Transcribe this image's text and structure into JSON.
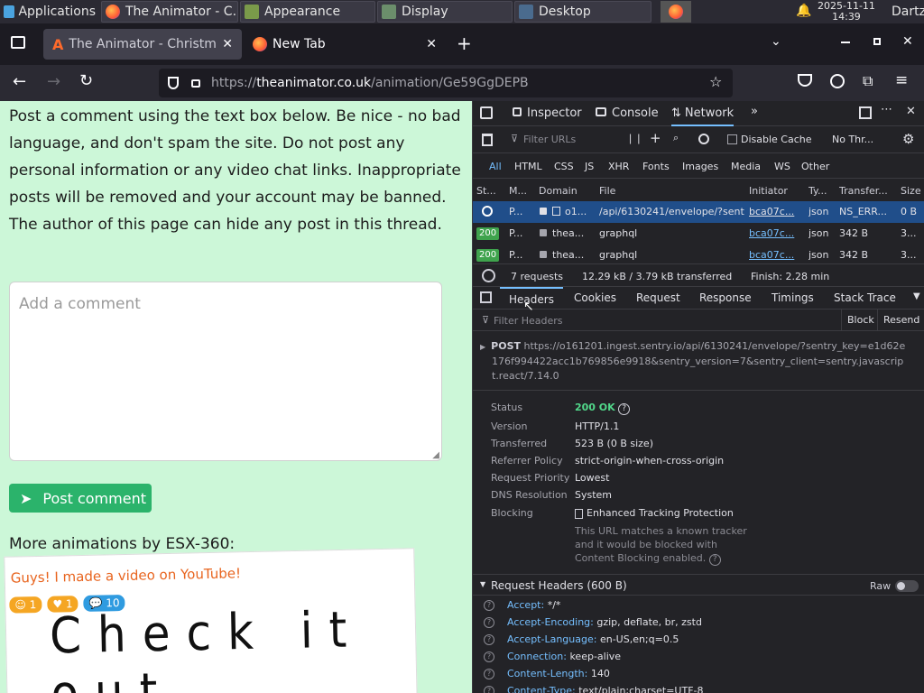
{
  "taskbar": {
    "applications_label": "Applications",
    "windows": [
      {
        "label": "The Animator - C..."
      },
      {
        "label": "Appearance"
      },
      {
        "label": "Display"
      },
      {
        "label": "Desktop"
      }
    ],
    "clock_date": "2025-11-11",
    "clock_time": "14:39",
    "user": "Dartz"
  },
  "tabs": [
    {
      "label": "The Animator - Christma",
      "active": true
    },
    {
      "label": "New Tab",
      "active": false
    }
  ],
  "url": {
    "prefix": "https://",
    "domain": "theanimator.co.uk",
    "path": "/animation/Ge59GgDEPB"
  },
  "page": {
    "notice": "Post a comment using the text box below. Be nice - no bad language, and don't spam the site. Do not post any personal information or any video chat links. Inappropriate posts will be removed and your account may be banned. The author of this page can hide any post in this thread.",
    "comment_placeholder": "Add a comment",
    "post_button": "Post comment",
    "more_by": "More animations by ESX-360:",
    "card_title": "Guys! I made a video on YouTube!",
    "card_counts": [
      "1",
      "1",
      "10"
    ],
    "card_drawing_text": "Check it out"
  },
  "devtools": {
    "tabs": [
      "Inspector",
      "Console",
      "Network"
    ],
    "filter_urls_placeholder": "Filter URLs",
    "disable_cache": "Disable Cache",
    "throttle": "No Thr...",
    "type_filters": [
      "All",
      "HTML",
      "CSS",
      "JS",
      "XHR",
      "Fonts",
      "Images",
      "Media",
      "WS",
      "Other"
    ],
    "columns": [
      "St...",
      "M...",
      "Domain",
      "File",
      "Initiator",
      "Ty...",
      "Transfer...",
      "Size"
    ],
    "requests": [
      {
        "status": "",
        "method": "P...",
        "domain": "o1...",
        "file": "/api/6130241/envelope/?sent",
        "initiator": "bca07c...",
        "type": "json",
        "transferred": "NS_ERR...",
        "size": "0 B",
        "selected": true
      },
      {
        "status": "200",
        "method": "P...",
        "domain": "thea...",
        "file": "graphql",
        "initiator": "bca07c...",
        "type": "json",
        "transferred": "342 B",
        "size": "3...",
        "selected": false
      },
      {
        "status": "200",
        "method": "P...",
        "domain": "thea...",
        "file": "graphql",
        "initiator": "bca07c...",
        "type": "json",
        "transferred": "342 B",
        "size": "3...",
        "selected": false
      }
    ],
    "summary_requests": "7 requests",
    "summary_transfer": "12.29 kB / 3.79 kB transferred",
    "summary_finish": "Finish: 2.28 min",
    "detail_tabs": [
      "Headers",
      "Cookies",
      "Request",
      "Response",
      "Timings",
      "Stack Trace"
    ],
    "filter_headers_placeholder": "Filter Headers",
    "block_label": "Block",
    "resend_label": "Resend",
    "request_line_method": "POST",
    "request_url_1": "https://o161201.ingest.sentry.io/api/6130241/envelope/?sentry_key=e1d62e",
    "request_url_2": "176f994422acc1b769856e9918&sentry_version=7&sentry_client=sentry.javascrip",
    "request_url_3": "t.react/7.14.0",
    "details": [
      {
        "key": "Status",
        "value": "200 OK"
      },
      {
        "key": "Version",
        "value": "HTTP/1.1"
      },
      {
        "key": "Transferred",
        "value": "523 B (0 B size)"
      },
      {
        "key": "Referrer Policy",
        "value": "strict-origin-when-cross-origin"
      },
      {
        "key": "Request Priority",
        "value": "Lowest"
      },
      {
        "key": "DNS Resolution",
        "value": "System"
      },
      {
        "key": "Blocking",
        "value": "Enhanced Tracking Protection"
      }
    ],
    "blocking_note_1": "This URL matches a known tracker",
    "blocking_note_2": "and it would be blocked with",
    "blocking_note_3": "Content Blocking enabled.",
    "request_headers_title": "Request Headers (600 B)",
    "raw_label": "Raw",
    "headers": [
      {
        "name": "Accept:",
        "value": "*/*"
      },
      {
        "name": "Accept-Encoding:",
        "value": "gzip, deflate, br, zstd"
      },
      {
        "name": "Accept-Language:",
        "value": "en-US,en;q=0.5"
      },
      {
        "name": "Connection:",
        "value": "keep-alive"
      },
      {
        "name": "Content-Length:",
        "value": "140"
      },
      {
        "name": "Content-Type:",
        "value": "text/plain;charset=UTF-8"
      }
    ]
  }
}
